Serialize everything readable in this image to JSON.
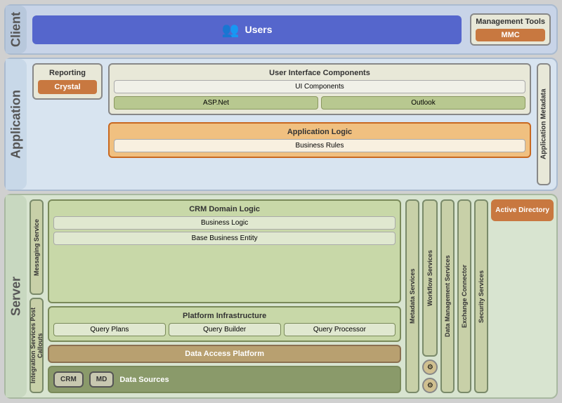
{
  "client": {
    "label": "Client",
    "users": {
      "label": "Users",
      "icon": "👥"
    },
    "management_tools": {
      "title": "Management Tools",
      "mmc": "MMC"
    }
  },
  "application": {
    "label": "Application",
    "reporting": {
      "title": "Reporting",
      "crystal": "Crystal"
    },
    "ui_components": {
      "title": "User Interface Components",
      "ui_components": "UI Components",
      "asp_net": "ASP.Net",
      "outlook": "Outlook"
    },
    "app_logic": {
      "title": "Application Logic",
      "business_rules": "Business Rules"
    },
    "app_metadata": "Application Metadata"
  },
  "server": {
    "label": "Server",
    "messaging": "Messaging Service",
    "integration": "Integration Services Post Callouts",
    "crm_domain": {
      "title": "CRM Domain Logic",
      "business_logic": "Business Logic",
      "base_business": "Base Business Entity"
    },
    "platform": {
      "title": "Platform Infrastructure",
      "query_plans": "Query Plans",
      "query_builder": "Query Builder",
      "query_processor": "Query Processor"
    },
    "data_access": "Data Access Platform",
    "data_sources": {
      "label": "Data Sources",
      "crm": "CRM",
      "md": "MD"
    },
    "metadata_services": "Metadata Services",
    "workflow_services": "Workflow Services",
    "data_mgmt": "Data Management Services",
    "exchange_connector": "Exchange Connector",
    "security_services": "Security Services",
    "active_directory": "Active Directory"
  }
}
